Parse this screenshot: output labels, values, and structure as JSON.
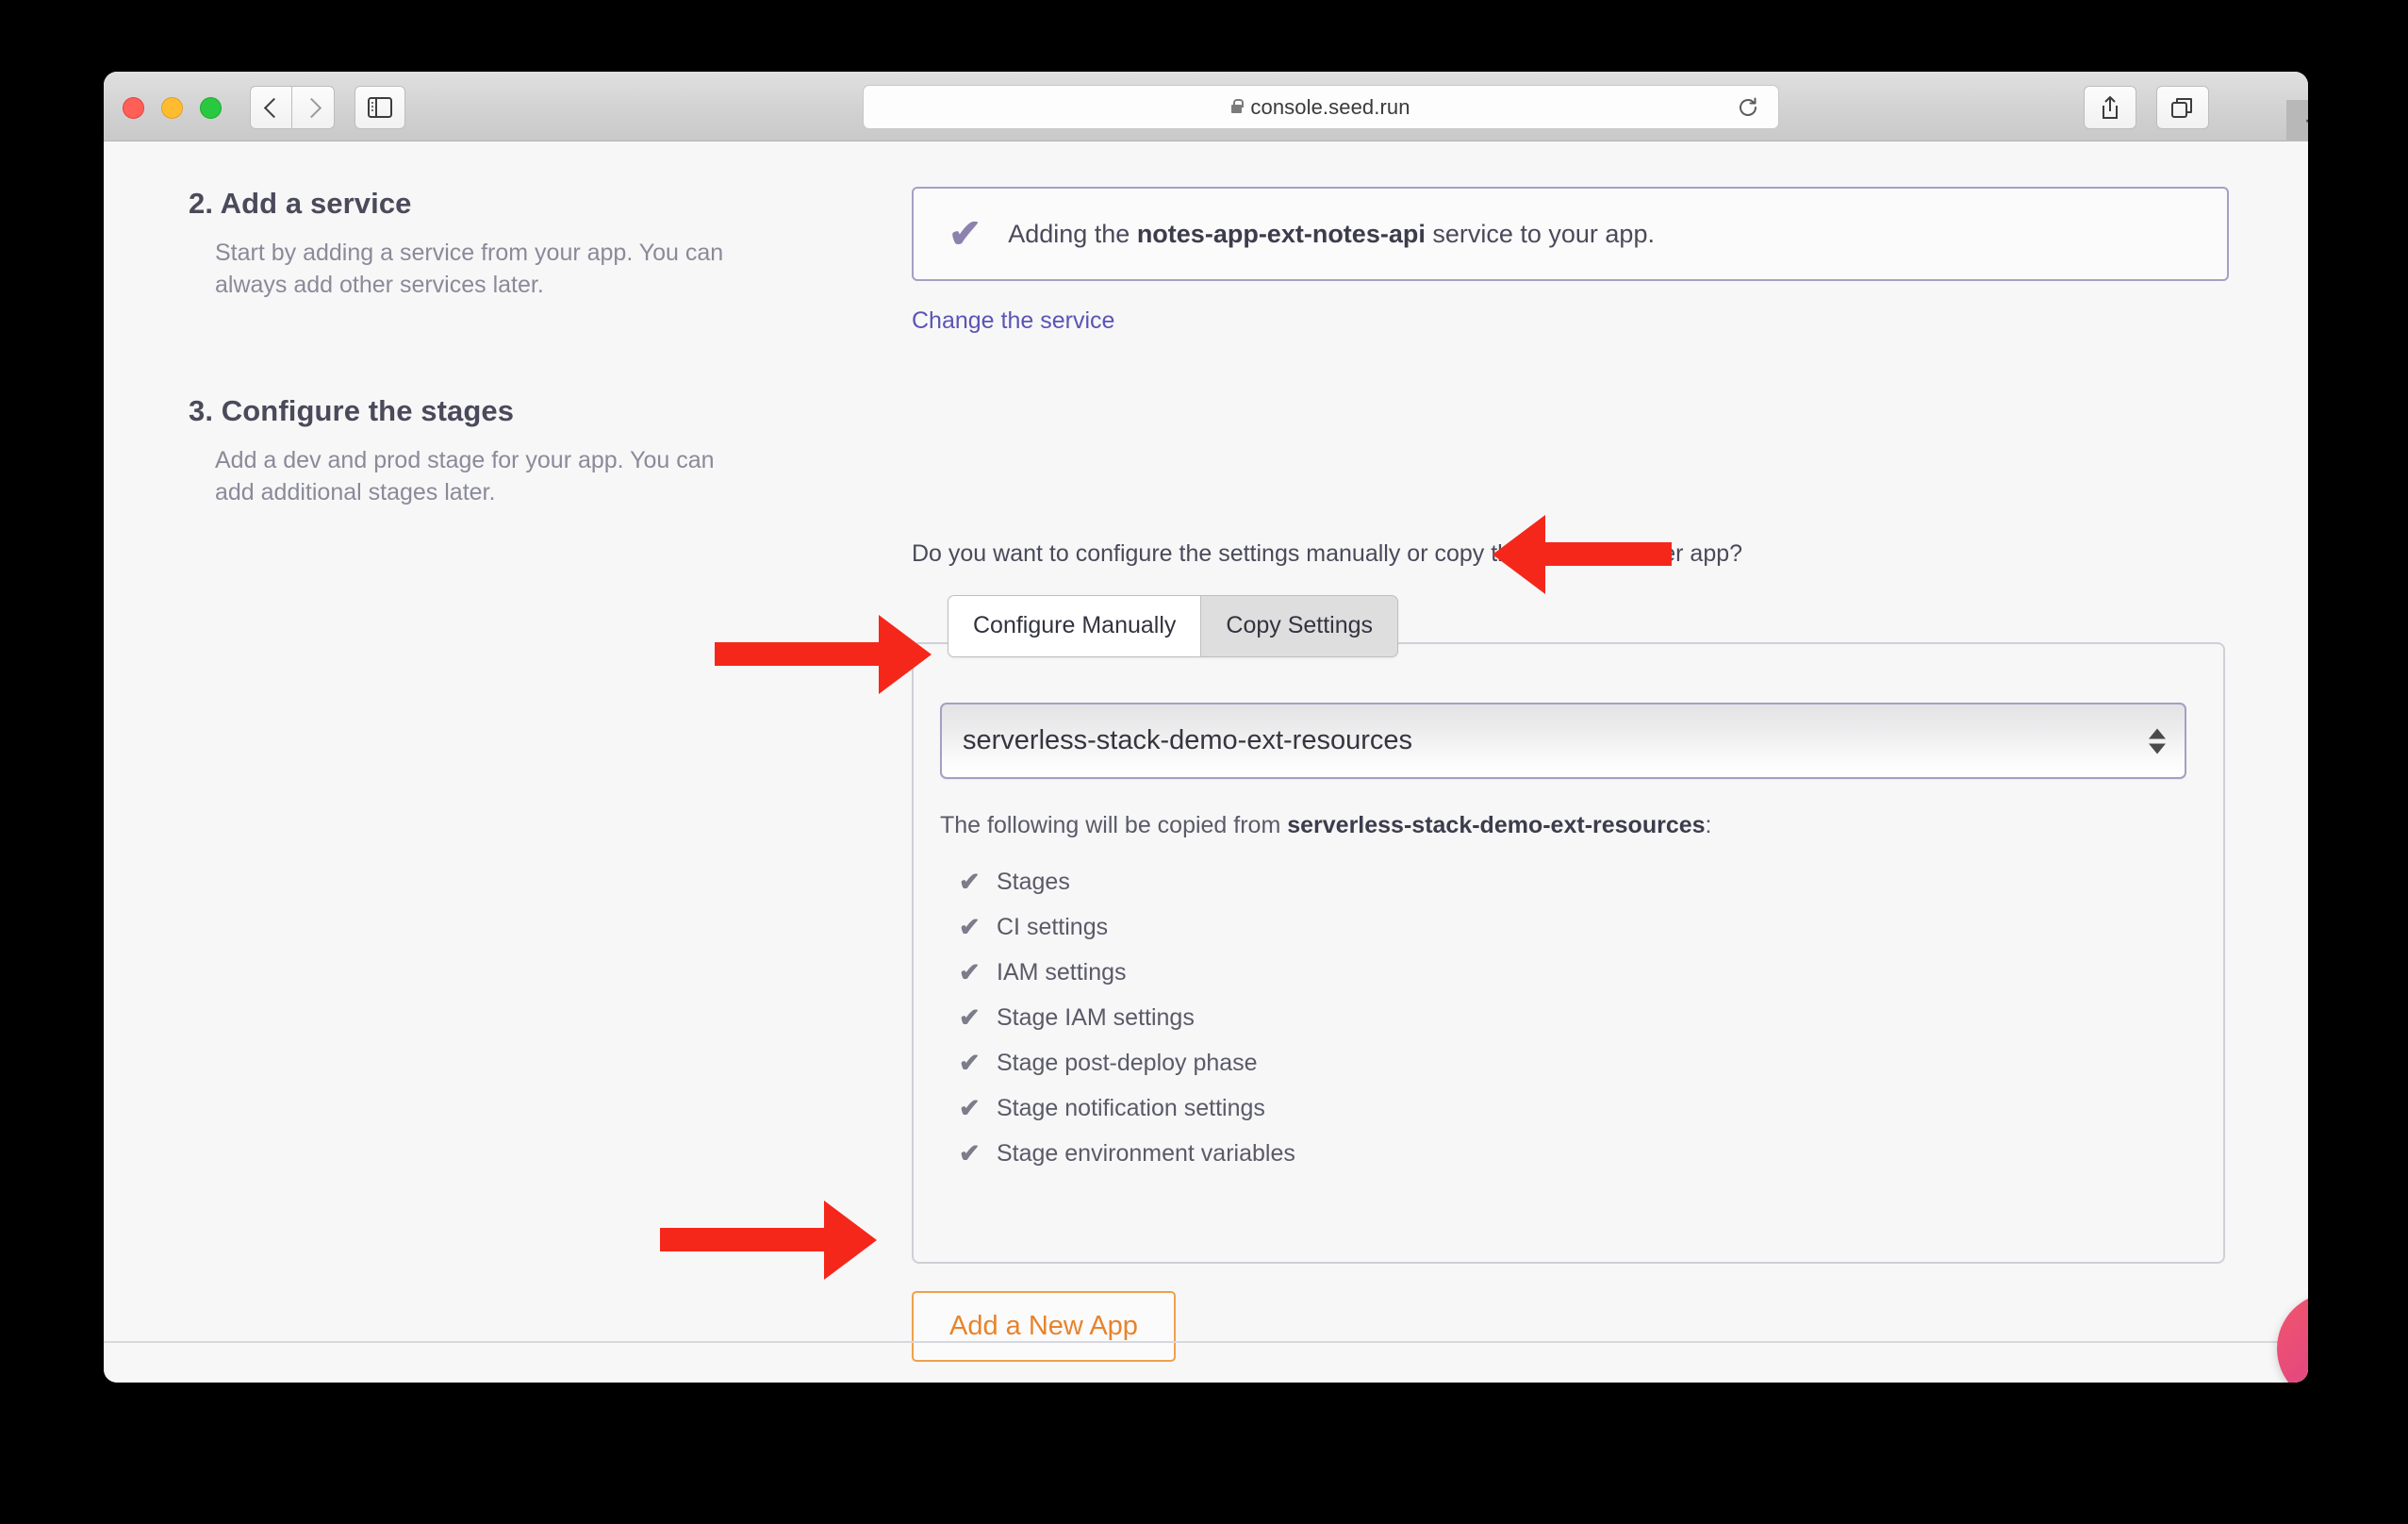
{
  "browser": {
    "url": "console.seed.run",
    "lock_icon": "lock-icon",
    "reload_icon": "reload-icon",
    "back_icon": "chevron-left-icon",
    "forward_icon": "chevron-right-icon",
    "sidebar_icon": "sidebar-toggle-icon",
    "share_icon": "share-icon",
    "tab_overview_icon": "tab-overview-icon",
    "new_tab_label": "+"
  },
  "step2": {
    "title": "2. Add a service",
    "description": "Start by adding a service from your app. You can always add other services later.",
    "banner": {
      "check_icon": "check-icon",
      "check_color": "#8c82ad",
      "text_before": "Adding the ",
      "service_name": "notes-app-ext-notes-api",
      "text_after": " service to your app."
    },
    "change_link": "Change the service"
  },
  "step3": {
    "title": "3. Configure the stages",
    "description": "Add a dev and prod stage for your app. You can add additional stages later.",
    "question": "Do you want to configure the settings manually or copy them from another app?",
    "tabs": [
      {
        "label": "Configure Manually",
        "active": false
      },
      {
        "label": "Copy Settings",
        "active": true
      }
    ],
    "select": {
      "value": "serverless-stack-demo-ext-resources",
      "stepper_icon": "stepper-updown-icon",
      "border_color": "#a79ec4"
    },
    "copy_from_prefix": "The following will be copied from ",
    "copy_from_app": "serverless-stack-demo-ext-resources",
    "copy_from_suffix": ":",
    "copy_items": [
      "Stages",
      "CI settings",
      "IAM settings",
      "Stage IAM settings",
      "Stage post-deploy phase",
      "Stage notification settings",
      "Stage environment variables"
    ],
    "item_check_icon": "check-icon"
  },
  "actions": {
    "add_app_label": "Add a New App",
    "add_app_color": "#e8832a"
  },
  "chat": {
    "icon": "chat-bubble-icon",
    "accent": "#e64a7c"
  },
  "annotations": {
    "arrow_color": "#f5271b",
    "arrows": [
      {
        "name": "arrow-to-copy-settings-tab",
        "direction": "left"
      },
      {
        "name": "arrow-to-app-select",
        "direction": "right"
      },
      {
        "name": "arrow-to-add-a-new-app-button",
        "direction": "right"
      }
    ]
  }
}
